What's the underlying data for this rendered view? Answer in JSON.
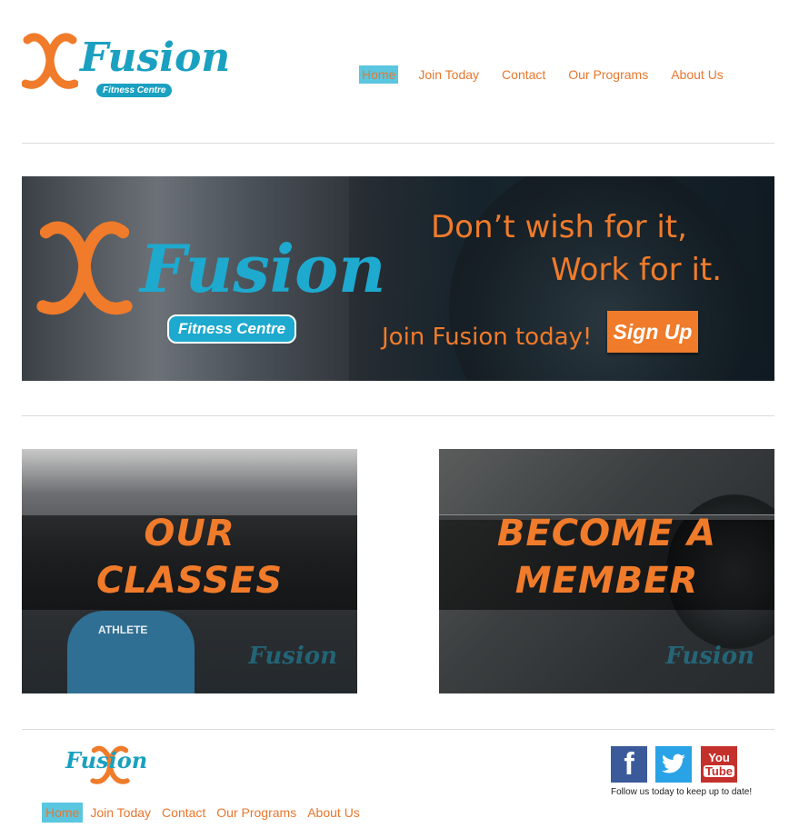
{
  "brand": {
    "name": "Fusion",
    "tagline": "Fitness Centre"
  },
  "nav": {
    "items": [
      {
        "label": "Home",
        "active": true
      },
      {
        "label": "Join Today",
        "active": false
      },
      {
        "label": "Contact",
        "active": false
      },
      {
        "label": "Our Programs",
        "active": false
      },
      {
        "label": "About Us",
        "active": false
      }
    ]
  },
  "banner": {
    "brand_name": "Fusion",
    "brand_tagline": "Fitness Centre",
    "slogan_line1": "Don’t wish for it,",
    "slogan_line2": "Work for it.",
    "join_text": "Join Fusion today!",
    "signup_label": "Sign Up"
  },
  "tiles": [
    {
      "line1": "OUR",
      "line2": "CLASSES",
      "watermark": "Fusion",
      "shirt_text": "ATHLETE"
    },
    {
      "line1": "BECOME A",
      "line2": "MEMBER",
      "watermark": "Fusion"
    }
  ],
  "footer": {
    "logo_text": "Fusion",
    "nav": [
      {
        "label": "Home",
        "active": true
      },
      {
        "label": "Join Today",
        "active": false
      },
      {
        "label": "Contact",
        "active": false
      },
      {
        "label": "Our Programs",
        "active": false
      },
      {
        "label": "About Us",
        "active": false
      }
    ],
    "social": {
      "facebook": "f",
      "twitter": "t",
      "youtube_line1": "You",
      "youtube_line2": "Tube"
    },
    "follow_text": "Follow us today to keep up to date!"
  },
  "colors": {
    "accent": "#f07b2a",
    "brand_blue": "#1aa0c0",
    "active_bg": "#5bc6e0"
  }
}
